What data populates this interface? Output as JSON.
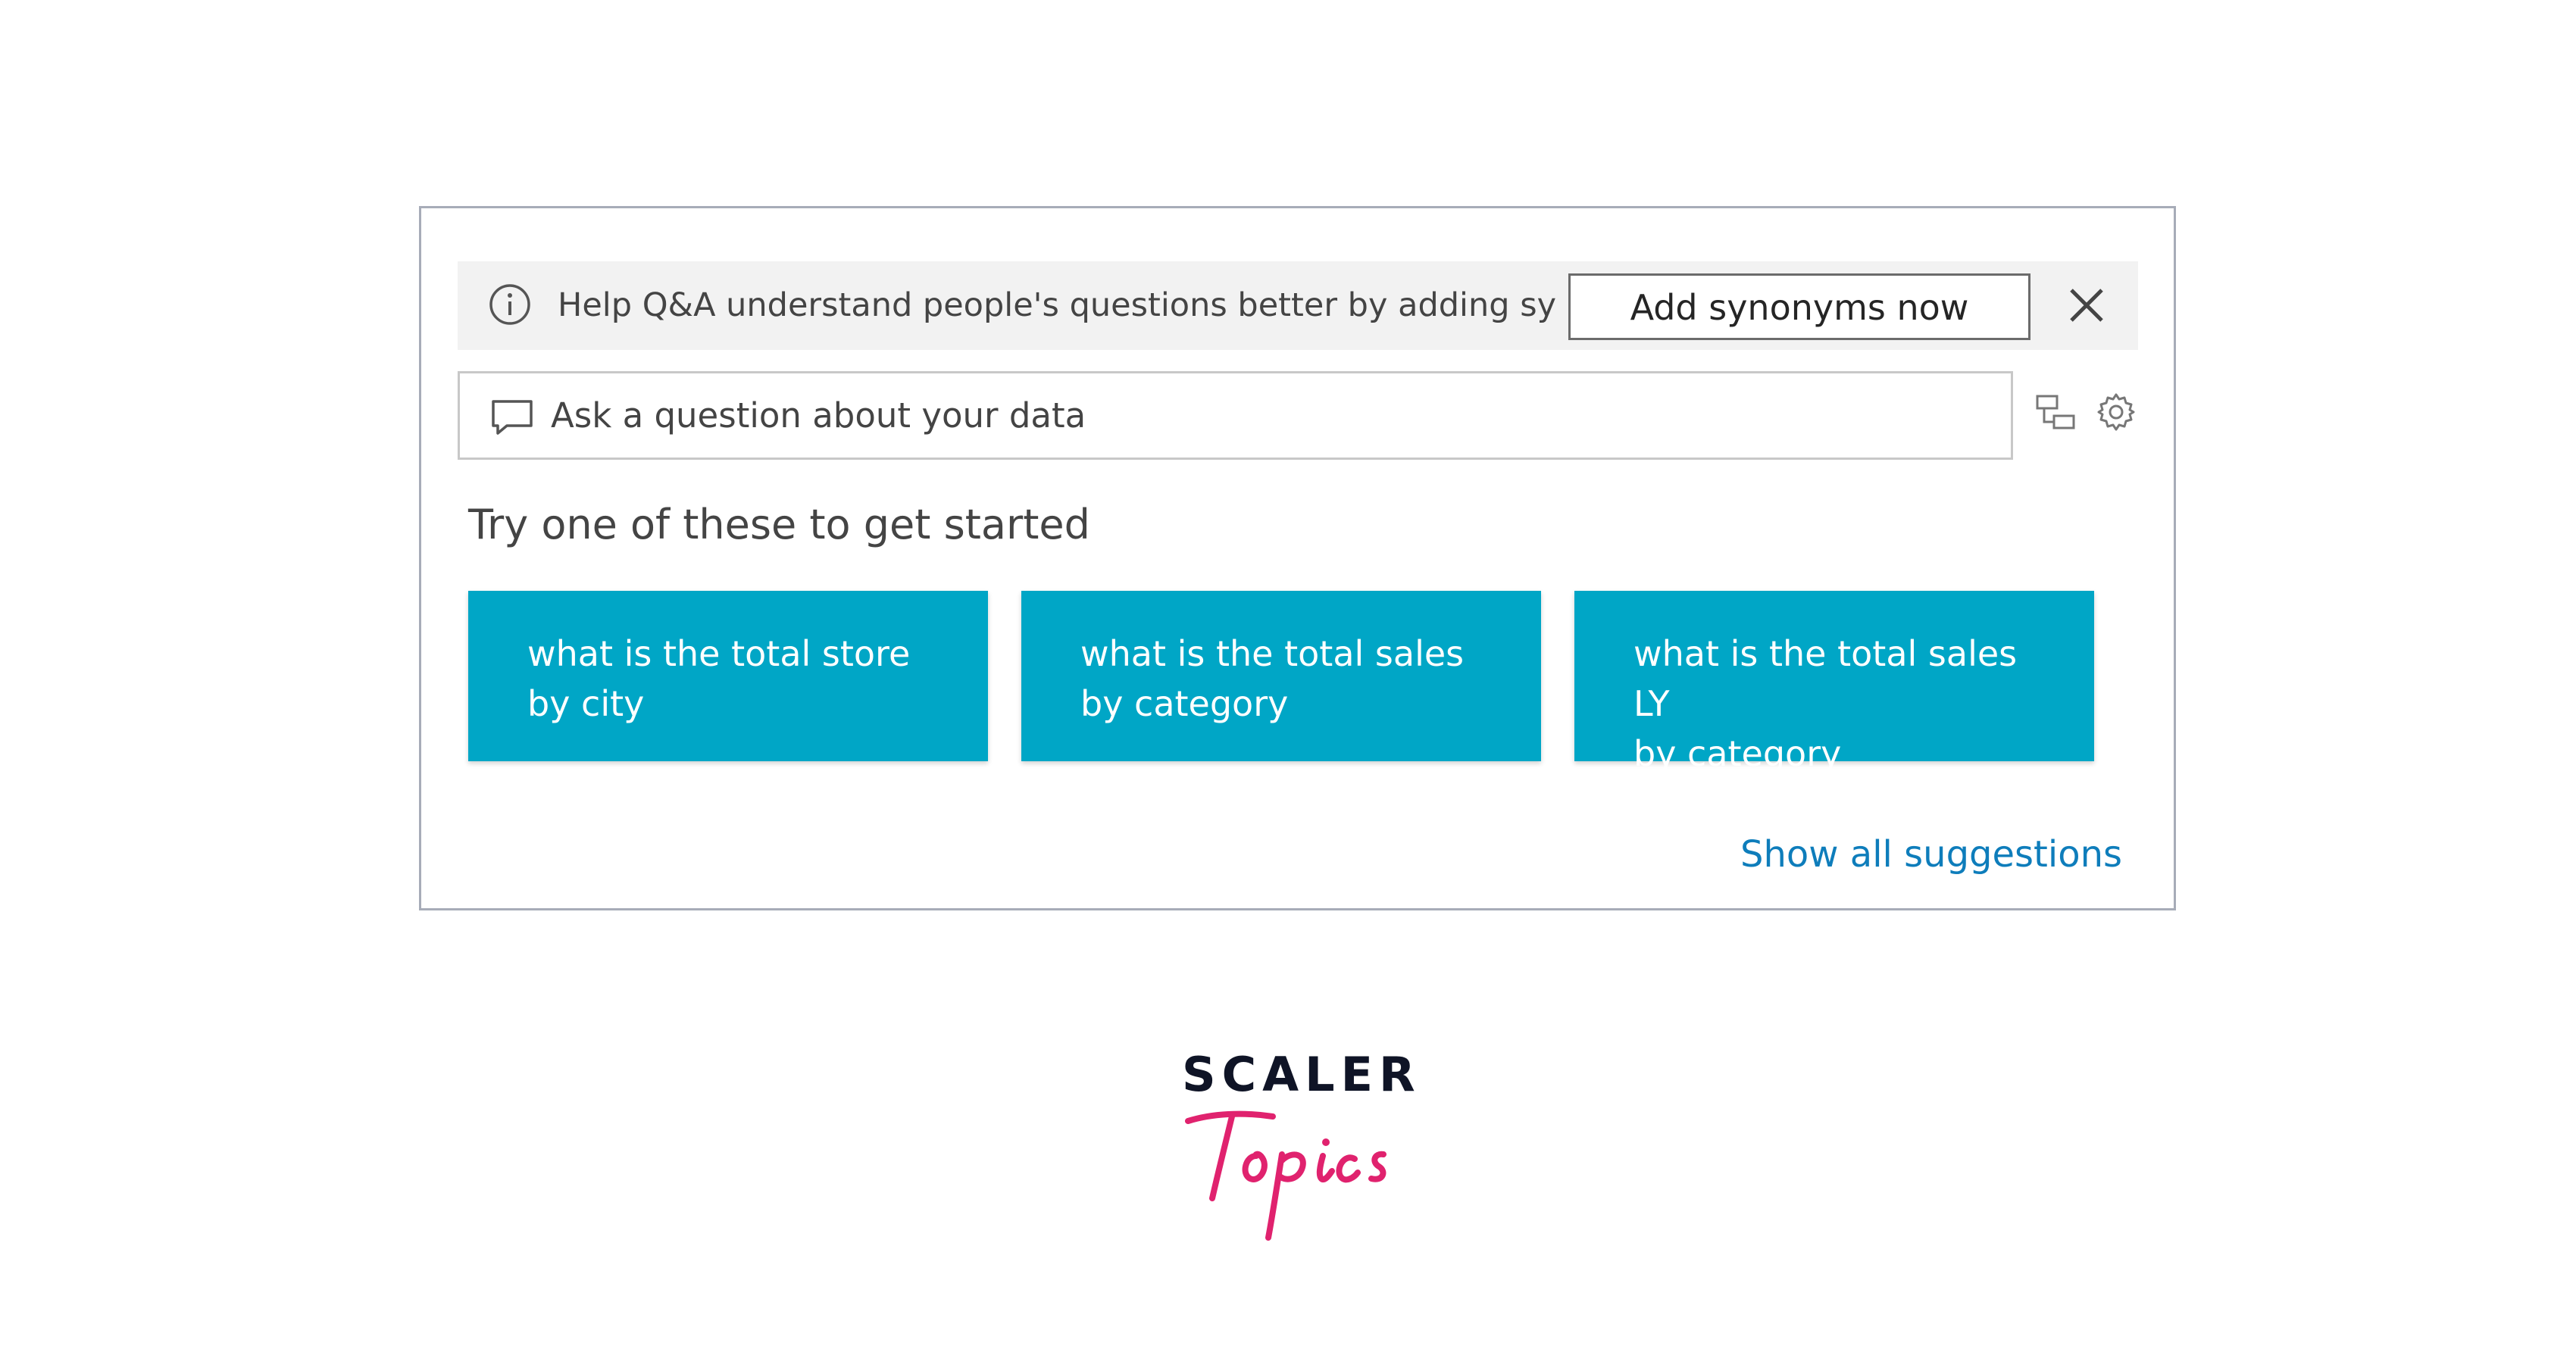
{
  "banner": {
    "text": "Help Q&A understand people's questions better by adding synon...",
    "button_label": "Add synonyms now"
  },
  "search": {
    "placeholder": "Ask a question about your data"
  },
  "suggestions": {
    "heading": "Try one of these to get started",
    "items": [
      {
        "label": "what is the total store\nby city"
      },
      {
        "label": "what is the total sales\nby category"
      },
      {
        "label": "what is the total sales LY\nby category"
      }
    ],
    "show_all_label": "Show all suggestions"
  },
  "logo": {
    "wordmark": "SCALER",
    "script": "Topics"
  },
  "colors": {
    "card": "#00a6c6",
    "link": "#0e7dbb",
    "banner_bg": "#f2f2f2",
    "logo_pink": "#e0226e",
    "logo_navy": "#0f1426"
  },
  "icons": {
    "info": "info-icon",
    "close": "close-icon",
    "chat": "chat-bubble-icon",
    "field_list": "field-list-icon",
    "settings": "gear-icon"
  }
}
